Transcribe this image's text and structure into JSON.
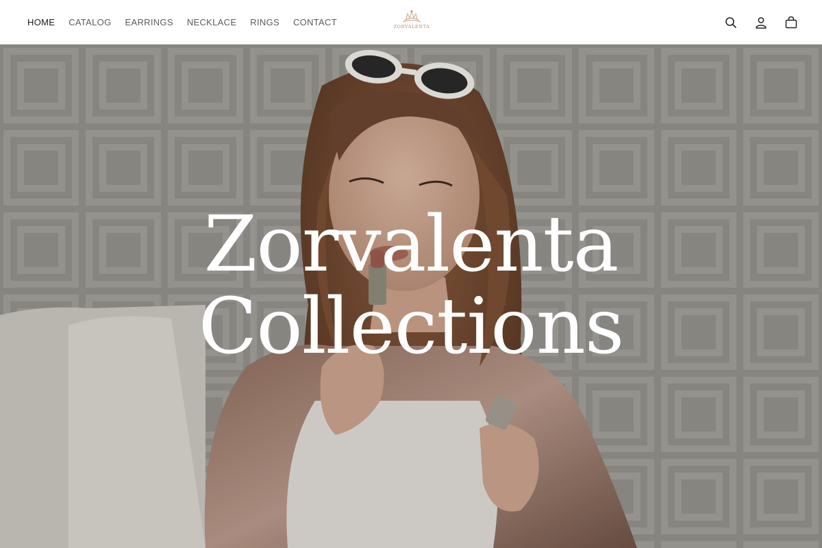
{
  "nav": {
    "items": [
      {
        "label": "HOME",
        "active": true
      },
      {
        "label": "CATALOG",
        "active": false
      },
      {
        "label": "EARRINGS",
        "active": false
      },
      {
        "label": "NECKLACE",
        "active": false
      },
      {
        "label": "RINGS",
        "active": false
      },
      {
        "label": "CONTACT",
        "active": false
      }
    ]
  },
  "logo": {
    "text": "ZORVALENTA",
    "icon": "crown-logo-icon",
    "color": "#b98a64"
  },
  "header_icons": [
    "search-icon",
    "account-icon",
    "cart-icon"
  ],
  "hero": {
    "title_line1": "Zorvalenta",
    "title_line2": "Collections",
    "image": "woman-applying-lipstick-photo"
  },
  "colors": {
    "nav_text": "#5a5a5a",
    "nav_active": "#1a1a1a",
    "hero_text": "#ffffff"
  }
}
